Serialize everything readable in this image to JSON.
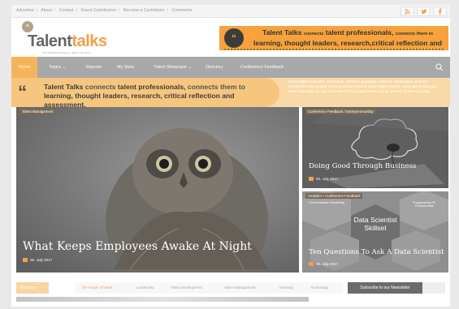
{
  "topbar": {
    "links": [
      "Advertise",
      "About",
      "Contact",
      "Guest Contributors",
      "Become a Contributor",
      "Comments"
    ],
    "social_icons": [
      "rss-icon",
      "twitter-icon",
      "facebook-icon"
    ]
  },
  "header": {
    "logo": {
      "prefix": "Talent",
      "suffix": "talks",
      "tagline": "The heartbeat of business. Talent. The future."
    },
    "banner": {
      "brand": "Talent Talks",
      "text_1": "connects",
      "text_2": "talent professionals,",
      "text_3": "connects them to",
      "text_4": "learning, thought leaders, research,critical reflection and assessment."
    }
  },
  "nav": {
    "items": [
      "Home",
      "Topics",
      "Reports",
      "My Story",
      "Talent Showcase",
      "Directory",
      "Conference Feedback"
    ],
    "active": "Home"
  },
  "strip": {
    "brand": "Talent Talks",
    "t1": "connects",
    "t2": "talent professionals,",
    "t3": "connects them to",
    "t4": "learning, thought leaders, research, critical reflection and assessment.",
    "description": "Talent Talks educates, entertains, informs, engages, inspires, challenges, pushes boundaries and ignites ongoing conversations in the talent space, cross-generationally, cross-culturally, across all levels of the organization and all sectors of the economy."
  },
  "featured": {
    "main": {
      "category": "Talent Management",
      "title": "What Keeps Employees Awake At Night",
      "date": "26. July 2017"
    },
    "side1": {
      "category": "Conference Feedback / Entrepreneurship",
      "title": "Doing Good Through Business",
      "date": "04. July 2017"
    },
    "side2": {
      "category": "Analytics / Conference Feedback",
      "title": "Ten Questions To Ask A Data Scientist",
      "date": "03. July 2017",
      "image_text": {
        "center": "Data Scientist Skillset",
        "left": "Communication Storytelling",
        "right": "Programming CS Fundamentals"
      }
    }
  },
  "tabs": {
    "sections_label": "Sections",
    "items": [
      "The Future Of Work",
      "Leadership",
      "Talent Development",
      "Talent Management",
      "Diversity",
      "Technology"
    ],
    "active": "The Future Of Work",
    "newsletter": "Subscribe to our Newsletter"
  },
  "colors": {
    "accent": "#f0a04b",
    "banner": "#f7a23c",
    "nav": "#a8a8a8"
  }
}
